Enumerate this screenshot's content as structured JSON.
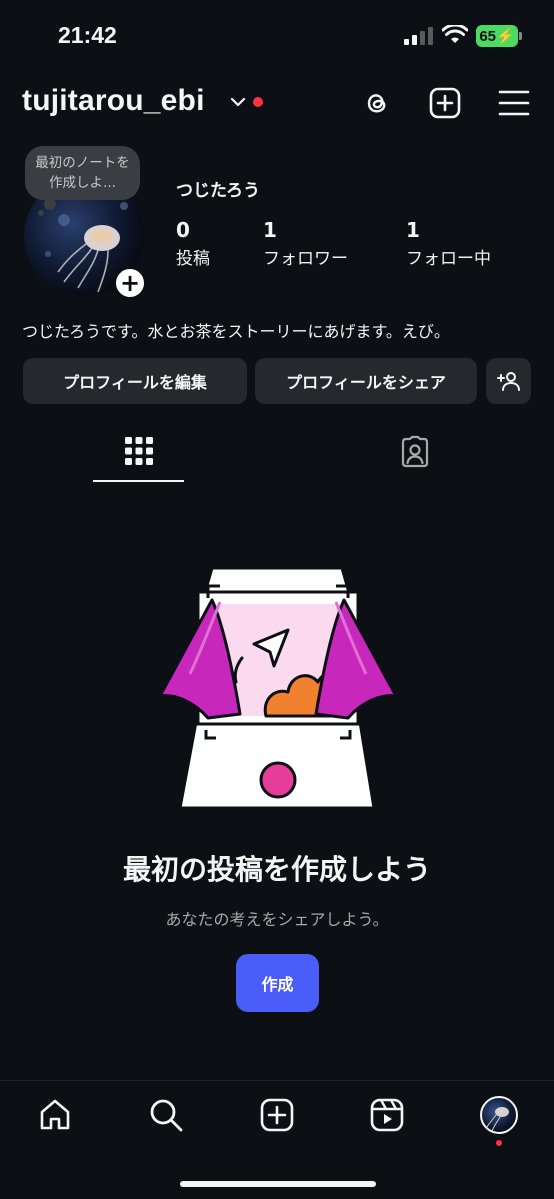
{
  "status_bar": {
    "time": "21:42",
    "battery": "65"
  },
  "header": {
    "username": "tujitarou_ebi"
  },
  "profile": {
    "note": "最初のノートを作成しよ...",
    "display_name": "つじたろう",
    "stats": [
      {
        "value": "0",
        "label": "投稿"
      },
      {
        "value": "1",
        "label": "フォロワー"
      },
      {
        "value": "1",
        "label": "フォロー中"
      }
    ],
    "bio": "つじたろうです。水とお茶をストーリーにあげます。えび。",
    "buttons": {
      "edit": "プロフィールを編集",
      "share": "プロフィールをシェア"
    }
  },
  "empty_state": {
    "title": "最初の投稿を作成しよう",
    "subtitle": "あなたの考えをシェアしよう。",
    "create_label": "作成"
  },
  "colors": {
    "accent": "#4a5df9",
    "notify": "#ff3040",
    "background": "#0c1014",
    "button": "#25292e"
  },
  "icons": {
    "header": [
      "threads-icon",
      "new-post-icon",
      "menu-icon"
    ],
    "nav": [
      "home-icon",
      "search-icon",
      "create-icon",
      "reels-icon",
      "profile-avatar"
    ]
  }
}
